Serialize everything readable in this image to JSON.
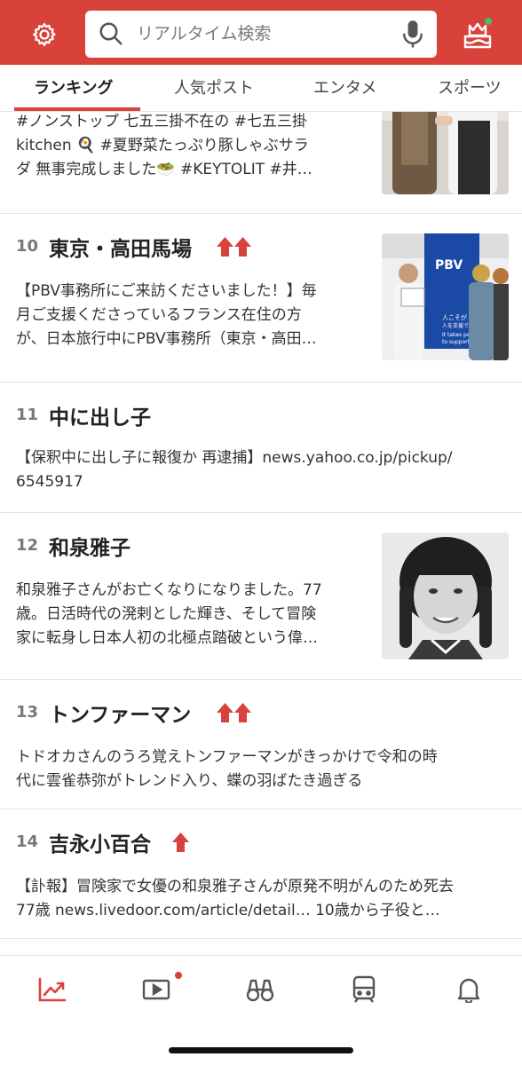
{
  "colors": {
    "brand": "#d9423a",
    "text": "#333333",
    "rank": "#777777"
  },
  "header": {
    "search_placeholder": "リアルタイム検索",
    "icons": [
      "gear-icon",
      "search-icon",
      "mic-icon",
      "trend-cake-icon"
    ]
  },
  "tabs": [
    {
      "label": "ランキング",
      "active": true
    },
    {
      "label": "人気ポスト",
      "active": false
    },
    {
      "label": "エンタメ",
      "active": false
    },
    {
      "label": "スポーツ",
      "active": false
    }
  ],
  "items": [
    {
      "rank": "",
      "keyword": "",
      "lines": [
        "#ノンストップ 七五三掛不在の #七五三掛",
        "kitchen 🍳 #夏野菜たっぷり豚しゃぶサラ",
        "ダ 無事完成しました🥗 #KEYTOLIT #井…"
      ]
    },
    {
      "rank": "10",
      "keyword": "東京・高田馬場",
      "trend": "double-up",
      "lines": [
        "【PBV事務所にご来訪くださいました！】毎",
        "月ご支援くださっているフランス在住の方",
        "が、日本旅行中にPBV事務所（東京・高田…"
      ],
      "thumb_text": {
        "sign": "PBV",
        "banner1": "人こそが",
        "banner2": "人を支援できる",
        "banner3": "It takes people",
        "banner4": "to support people"
      }
    },
    {
      "rank": "11",
      "keyword": "中に出し子",
      "lines": [
        "【保釈中に出し子に報復か 再逮捕】news.yahoo.co.jp/pickup/",
        "6545917"
      ]
    },
    {
      "rank": "12",
      "keyword": "和泉雅子",
      "lines": [
        "和泉雅子さんがお亡くなりになりました。77",
        "歳。日活時代の溌剌とした輝き、そして冒険",
        "家に転身し日本人初の北極点踏破という偉…"
      ]
    },
    {
      "rank": "13",
      "keyword": "トンファーマン",
      "trend": "double-up",
      "lines": [
        "トドオカさんのうろ覚えトンファーマンがきっかけで令和の時",
        "代に雲雀恭弥がトレンド入り、蝶の羽ばたき過ぎる"
      ]
    },
    {
      "rank": "14",
      "keyword": "吉永小百合",
      "trend": "up",
      "lines": [
        "【訃報】冒険家で女優の和泉雅子さんが原発不明がんのため死去",
        "77歳 news.livedoor.com/article/detail… 10歳から子役と…"
      ]
    }
  ],
  "bottom_nav": [
    "trend-chart-icon",
    "video-play-icon",
    "binoculars-icon",
    "train-icon",
    "bell-icon"
  ]
}
